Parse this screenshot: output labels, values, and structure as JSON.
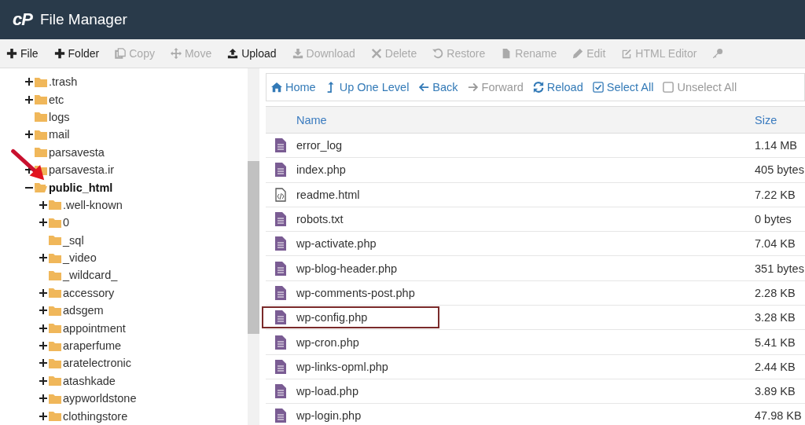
{
  "header": {
    "logo": "cP",
    "title": "File Manager"
  },
  "toolbar": [
    {
      "kind": "plus",
      "label": "File",
      "disabled": false
    },
    {
      "kind": "plus",
      "label": "Folder",
      "disabled": false
    },
    {
      "kind": "copy",
      "label": "Copy",
      "disabled": true
    },
    {
      "kind": "move",
      "label": "Move",
      "disabled": true
    },
    {
      "kind": "upload",
      "label": "Upload",
      "disabled": false
    },
    {
      "kind": "download",
      "label": "Download",
      "disabled": true
    },
    {
      "kind": "delete",
      "label": "Delete",
      "disabled": true
    },
    {
      "kind": "restore",
      "label": "Restore",
      "disabled": true
    },
    {
      "kind": "rename",
      "label": "Rename",
      "disabled": true
    },
    {
      "kind": "edit",
      "label": "Edit",
      "disabled": true
    },
    {
      "kind": "htmledit",
      "label": "HTML Editor",
      "disabled": true
    },
    {
      "kind": "key",
      "disabled": true
    }
  ],
  "tree": [
    {
      "name": ".trash",
      "expandable": true,
      "expanded": false,
      "selected": false
    },
    {
      "name": "etc",
      "expandable": true,
      "expanded": false,
      "selected": false
    },
    {
      "name": "logs",
      "expandable": false,
      "expanded": false,
      "selected": false
    },
    {
      "name": "mail",
      "expandable": true,
      "expanded": false,
      "selected": false
    },
    {
      "name": "parsavesta",
      "expandable": false,
      "expanded": false,
      "selected": false
    },
    {
      "name": "parsavesta.ir",
      "expandable": true,
      "expanded": false,
      "selected": false
    },
    {
      "name": "public_html",
      "expandable": true,
      "expanded": true,
      "selected": true,
      "children": [
        {
          "name": ".well-known",
          "expandable": true,
          "expanded": false,
          "selected": false
        },
        {
          "name": "0",
          "expandable": true,
          "expanded": false,
          "selected": false
        },
        {
          "name": "_sql",
          "expandable": false,
          "expanded": false,
          "selected": false
        },
        {
          "name": "_video",
          "expandable": true,
          "expanded": false,
          "selected": false
        },
        {
          "name": "_wildcard_",
          "expandable": false,
          "expanded": false,
          "selected": false
        },
        {
          "name": "accessory",
          "expandable": true,
          "expanded": false,
          "selected": false
        },
        {
          "name": "adsgem",
          "expandable": true,
          "expanded": false,
          "selected": false
        },
        {
          "name": "appointment",
          "expandable": true,
          "expanded": false,
          "selected": false
        },
        {
          "name": "araperfume",
          "expandable": true,
          "expanded": false,
          "selected": false
        },
        {
          "name": "aratelectronic",
          "expandable": true,
          "expanded": false,
          "selected": false
        },
        {
          "name": "atashkade",
          "expandable": true,
          "expanded": false,
          "selected": false
        },
        {
          "name": "aypworldstone",
          "expandable": true,
          "expanded": false,
          "selected": false
        },
        {
          "name": "clothingstore",
          "expandable": true,
          "expanded": false,
          "selected": false
        }
      ]
    }
  ],
  "nav": [
    {
      "kind": "home",
      "label": "Home",
      "disabled": false
    },
    {
      "kind": "up",
      "label": "Up One Level",
      "disabled": false
    },
    {
      "kind": "back",
      "label": "Back",
      "disabled": false
    },
    {
      "kind": "forward",
      "label": "Forward",
      "disabled": true
    },
    {
      "kind": "reload",
      "label": "Reload",
      "disabled": false
    },
    {
      "kind": "selectall",
      "label": "Select All",
      "disabled": false
    },
    {
      "kind": "unselectall",
      "label": "Unselect All",
      "disabled": true
    }
  ],
  "table": {
    "columns": [
      "Name",
      "Size"
    ],
    "rows": [
      {
        "kind": "text",
        "name": "error_log",
        "size": "1.14 MB",
        "outlined": false
      },
      {
        "kind": "text",
        "name": "index.php",
        "size": "405 bytes",
        "outlined": false
      },
      {
        "kind": "html",
        "name": "readme.html",
        "size": "7.22 KB",
        "outlined": false
      },
      {
        "kind": "text",
        "name": "robots.txt",
        "size": "0 bytes",
        "outlined": false
      },
      {
        "kind": "text",
        "name": "wp-activate.php",
        "size": "7.04 KB",
        "outlined": false
      },
      {
        "kind": "text",
        "name": "wp-blog-header.php",
        "size": "351 bytes",
        "outlined": false
      },
      {
        "kind": "text",
        "name": "wp-comments-post.php",
        "size": "2.28 KB",
        "outlined": false
      },
      {
        "kind": "text",
        "name": "wp-config.php",
        "size": "3.28 KB",
        "outlined": true
      },
      {
        "kind": "text",
        "name": "wp-cron.php",
        "size": "5.41 KB",
        "outlined": false
      },
      {
        "kind": "text",
        "name": "wp-links-opml.php",
        "size": "2.44 KB",
        "outlined": false
      },
      {
        "kind": "text",
        "name": "wp-load.php",
        "size": "3.89 KB",
        "outlined": false
      },
      {
        "kind": "text",
        "name": "wp-login.php",
        "size": "47.98 KB",
        "outlined": false
      }
    ]
  }
}
